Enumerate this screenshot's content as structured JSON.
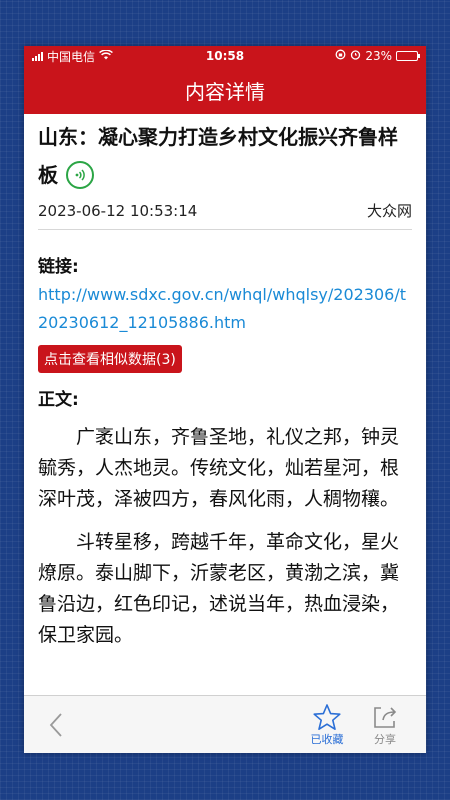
{
  "status": {
    "carrier": "中国电信",
    "time": "10:58",
    "battery": "23%",
    "battery_level": 0.23
  },
  "nav": {
    "title": "内容详情"
  },
  "article": {
    "title": "山东：凝心聚力打造乡村文化振兴齐鲁样板",
    "datetime": "2023-06-12 10:53:14",
    "source": "大众网",
    "link_label": "链接:",
    "link_url": "http://www.sdxc.gov.cn/whql/whqlsy/202306/t20230612_12105886.htm",
    "similar_button": "点击查看相似数据(3)",
    "body_label": "正文:",
    "paragraphs": [
      "广袤山东，齐鲁圣地，礼仪之邦，钟灵毓秀，人杰地灵。传统文化，灿若星河，根深叶茂，泽被四方，春风化雨，人稠物穰。",
      "斗转星移，跨越千年，革命文化，星火燎原。泰山脚下，沂蒙老区，黄渤之滨，冀鲁沿边，红色印记，述说当年，热血浸染，保卫家园。"
    ]
  },
  "toolbar": {
    "favorite_label": "已收藏",
    "share_label": "分享"
  },
  "colors": {
    "brand_red": "#c9141b",
    "link_blue": "#1a8ad6",
    "audio_green": "#2ba545",
    "favorite_blue": "#2b6fd6"
  }
}
